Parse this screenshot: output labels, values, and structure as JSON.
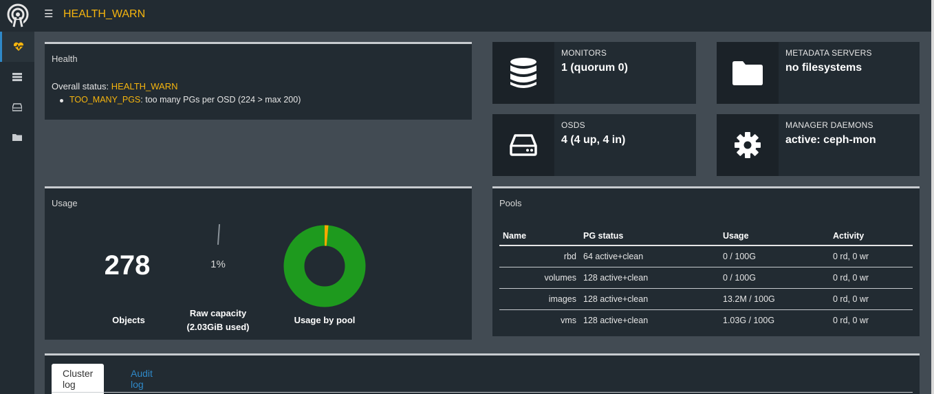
{
  "topbar": {
    "title": "HEALTH_WARN"
  },
  "sidebar": {
    "items": [
      {
        "icon": "heartbeat-icon",
        "active": true
      },
      {
        "icon": "server-list-icon",
        "active": false
      },
      {
        "icon": "hard-drive-icon",
        "active": false
      },
      {
        "icon": "folder-icon",
        "active": false
      }
    ]
  },
  "health": {
    "title": "Health",
    "overall_label": "Overall status: ",
    "overall_value": "HEALTH_WARN",
    "check_code": "TOO_MANY_PGS",
    "check_message": ": too many PGs per OSD (224 > max 200)"
  },
  "stats": {
    "monitors": {
      "label": "MONITORS",
      "value": "1 (quorum 0)",
      "icon": "database-icon"
    },
    "mds": {
      "label": "METADATA SERVERS",
      "value": "no filesystems",
      "icon": "folder-icon"
    },
    "osds": {
      "label": "OSDS",
      "value": "4 (4 up, 4 in)",
      "icon": "hard-drive-icon"
    },
    "mgr": {
      "label": "MANAGER DAEMONS",
      "value": "active: ceph-mon",
      "icon": "gear-icon"
    }
  },
  "usage": {
    "title": "Usage",
    "objects_value": "278",
    "objects_label": "Objects",
    "raw_pct": "1%",
    "raw_fraction": 0.01,
    "raw_label_1": "Raw capacity",
    "raw_label_2": "(2.03GiB used)",
    "pool_chart_label": "Usage by pool",
    "donut_colors": {
      "main": "#1e9a1e",
      "accent": "#f6a800"
    },
    "donut_accent_fraction": 0.015
  },
  "pools": {
    "title": "Pools",
    "columns": [
      "Name",
      "PG status",
      "Usage",
      "Activity"
    ],
    "rows": [
      {
        "name": "rbd",
        "pg": "64 active+clean",
        "usage": "0 / 100G",
        "activity": "0 rd, 0 wr"
      },
      {
        "name": "volumes",
        "pg": "128 active+clean",
        "usage": "0 / 100G",
        "activity": "0 rd, 0 wr"
      },
      {
        "name": "images",
        "pg": "128 active+clean",
        "usage": "13.2M / 100G",
        "activity": "0 rd, 0 wr"
      },
      {
        "name": "vms",
        "pg": "128 active+clean",
        "usage": "1.03G / 100G",
        "activity": "0 rd, 0 wr"
      }
    ]
  },
  "logs": {
    "tabs": [
      {
        "label": "Cluster log",
        "active": true
      },
      {
        "label": "Audit log",
        "active": false
      }
    ]
  },
  "colors": {
    "warn": "#f6b50e",
    "ok": "#3fbf3f",
    "link": "#2f89c8",
    "panel": "#222b32",
    "bg": "#424b53"
  }
}
